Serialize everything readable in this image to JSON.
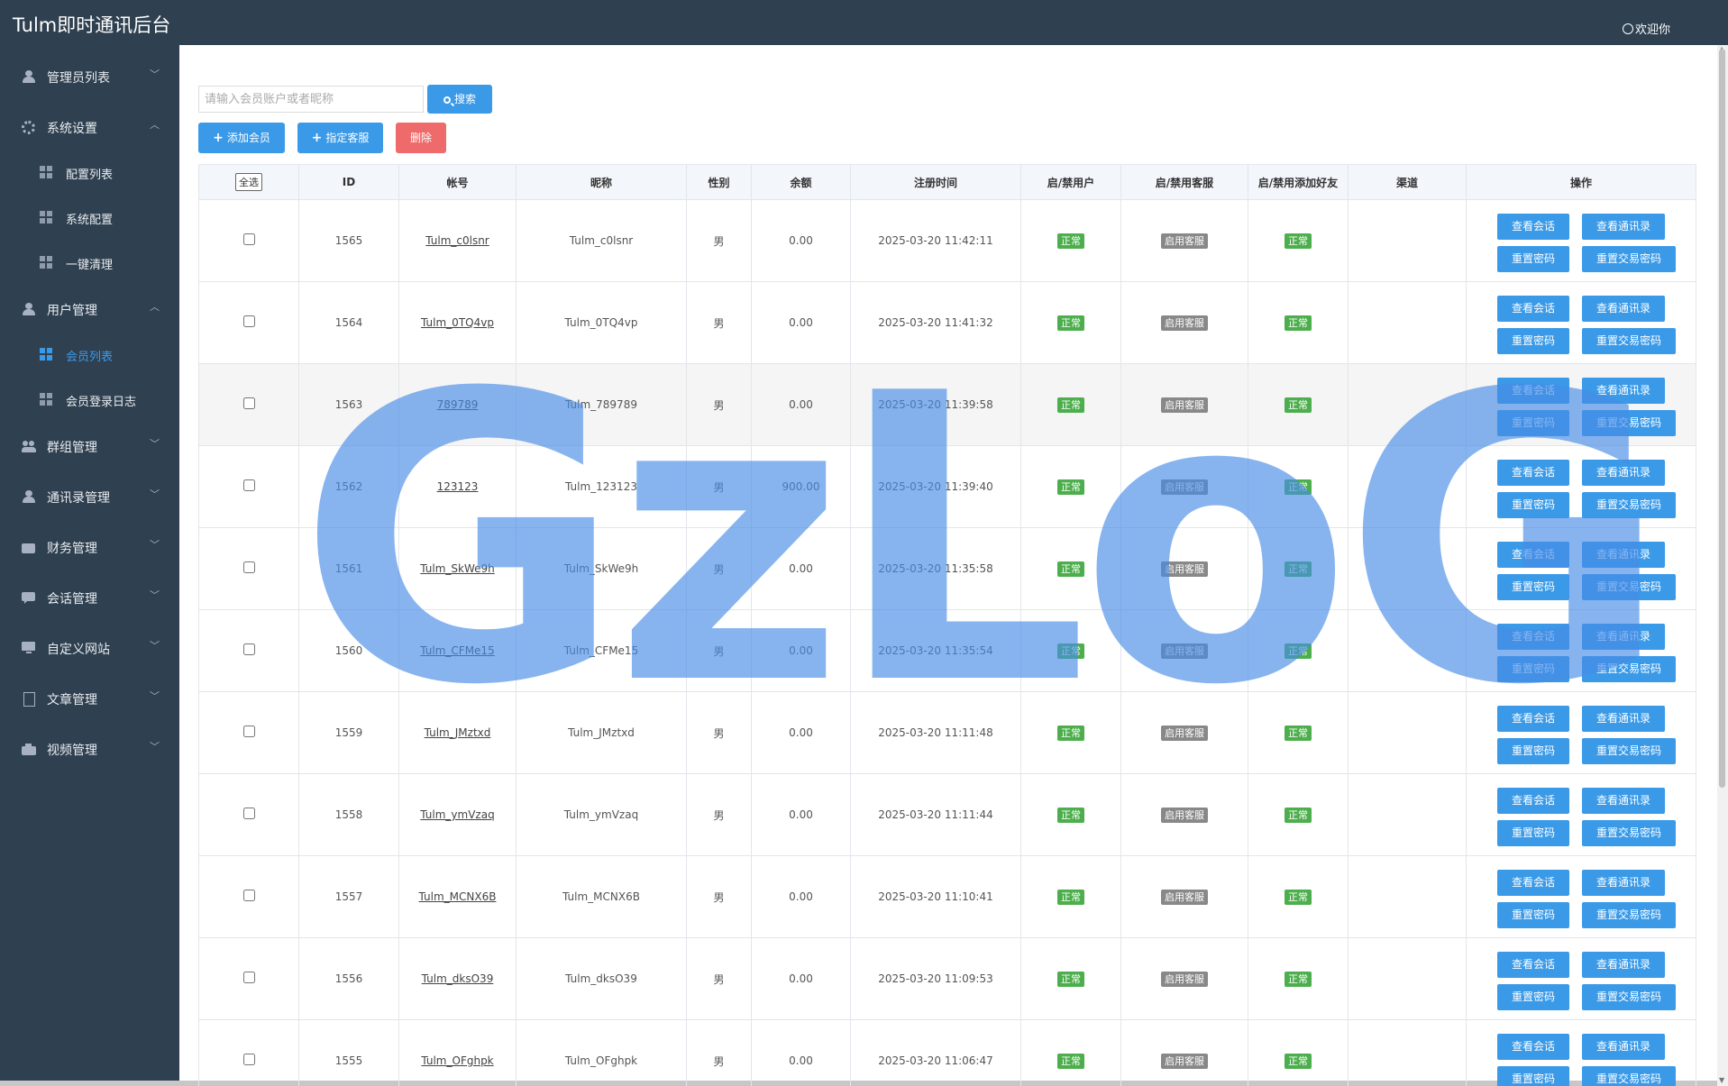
{
  "app": {
    "title": "Tulm即时通讯后台",
    "welcome": "欢迎你"
  },
  "sidebar": {
    "groups": [
      {
        "label": "管理员列表",
        "icon": "person-icon",
        "expanded": false
      },
      {
        "label": "系统设置",
        "icon": "gear-icon",
        "expanded": true,
        "items": [
          {
            "label": "配置列表"
          },
          {
            "label": "系统配置"
          },
          {
            "label": "一键清理"
          }
        ]
      },
      {
        "label": "用户管理",
        "icon": "person-icon",
        "expanded": true,
        "items": [
          {
            "label": "会员列表",
            "active": true
          },
          {
            "label": "会员登录日志"
          }
        ]
      },
      {
        "label": "群组管理",
        "icon": "group-icon",
        "expanded": false
      },
      {
        "label": "通讯录管理",
        "icon": "person-icon",
        "expanded": false
      },
      {
        "label": "财务管理",
        "icon": "money-icon",
        "expanded": false
      },
      {
        "label": "会话管理",
        "icon": "chat-icon",
        "expanded": false
      },
      {
        "label": "自定义网站",
        "icon": "monitor-icon",
        "expanded": false
      },
      {
        "label": "文章管理",
        "icon": "doc-icon",
        "expanded": false
      },
      {
        "label": "视频管理",
        "icon": "camera-icon",
        "expanded": false
      }
    ]
  },
  "toolbar": {
    "search_placeholder": "请输入会员账户或者昵称",
    "search_label": "搜索",
    "add_label": "添加会员",
    "assign_label": "指定客服",
    "delete_label": "删除"
  },
  "table": {
    "headers": {
      "select_all": "全选",
      "id": "ID",
      "account": "帐号",
      "nickname": "昵称",
      "gender": "性别",
      "balance": "余额",
      "reg_time": "注册时间",
      "user_status": "启/禁用户",
      "cs_status": "启/禁用客服",
      "friend_status": "启/禁用添加好友",
      "channel": "渠道",
      "ops": "操作"
    },
    "ops_labels": {
      "view_chat": "查看会话",
      "view_contacts": "查看通讯录",
      "reset_pwd": "重置密码",
      "reset_trade_pwd": "重置交易密码"
    },
    "rows": [
      {
        "id": "1565",
        "account": "Tulm_c0lsnr",
        "nickname": "Tulm_c0lsnr",
        "gender": "男",
        "balance": "0.00",
        "reg_time": "2025-03-20 11:42:11",
        "user_status": "正常",
        "cs_status": "启用客服",
        "friend_status": "正常",
        "channel": ""
      },
      {
        "id": "1564",
        "account": "Tulm_0TQ4vp",
        "nickname": "Tulm_0TQ4vp",
        "gender": "男",
        "balance": "0.00",
        "reg_time": "2025-03-20 11:41:32",
        "user_status": "正常",
        "cs_status": "启用客服",
        "friend_status": "正常",
        "channel": ""
      },
      {
        "id": "1563",
        "account": "789789",
        "nickname": "Tulm_789789",
        "gender": "男",
        "balance": "0.00",
        "reg_time": "2025-03-20 11:39:58",
        "user_status": "正常",
        "cs_status": "启用客服",
        "friend_status": "正常",
        "channel": ""
      },
      {
        "id": "1562",
        "account": "123123",
        "nickname": "Tulm_123123",
        "gender": "男",
        "balance": "900.00",
        "reg_time": "2025-03-20 11:39:40",
        "user_status": "正常",
        "cs_status": "启用客服",
        "friend_status": "正常",
        "channel": ""
      },
      {
        "id": "1561",
        "account": "Tulm_SkWe9h",
        "nickname": "Tulm_SkWe9h",
        "gender": "男",
        "balance": "0.00",
        "reg_time": "2025-03-20 11:35:58",
        "user_status": "正常",
        "cs_status": "启用客服",
        "friend_status": "正常",
        "channel": ""
      },
      {
        "id": "1560",
        "account": "Tulm_CFMe15",
        "nickname": "Tulm_CFMe15",
        "gender": "男",
        "balance": "0.00",
        "reg_time": "2025-03-20 11:35:54",
        "user_status": "正常",
        "cs_status": "启用客服",
        "friend_status": "正常",
        "channel": ""
      },
      {
        "id": "1559",
        "account": "Tulm_JMztxd",
        "nickname": "Tulm_JMztxd",
        "gender": "男",
        "balance": "0.00",
        "reg_time": "2025-03-20 11:11:48",
        "user_status": "正常",
        "cs_status": "启用客服",
        "friend_status": "正常",
        "channel": ""
      },
      {
        "id": "1558",
        "account": "Tulm_ymVzaq",
        "nickname": "Tulm_ymVzaq",
        "gender": "男",
        "balance": "0.00",
        "reg_time": "2025-03-20 11:11:44",
        "user_status": "正常",
        "cs_status": "启用客服",
        "friend_status": "正常",
        "channel": ""
      },
      {
        "id": "1557",
        "account": "Tulm_MCNX6B",
        "nickname": "Tulm_MCNX6B",
        "gender": "男",
        "balance": "0.00",
        "reg_time": "2025-03-20 11:10:41",
        "user_status": "正常",
        "cs_status": "启用客服",
        "friend_status": "正常",
        "channel": ""
      },
      {
        "id": "1556",
        "account": "Tulm_dksO39",
        "nickname": "Tulm_dksO39",
        "gender": "男",
        "balance": "0.00",
        "reg_time": "2025-03-20 11:09:53",
        "user_status": "正常",
        "cs_status": "启用客服",
        "friend_status": "正常",
        "channel": ""
      },
      {
        "id": "1555",
        "account": "Tulm_OFghpk",
        "nickname": "Tulm_OFghpk",
        "gender": "男",
        "balance": "0.00",
        "reg_time": "2025-03-20 11:06:47",
        "user_status": "正常",
        "cs_status": "启用客服",
        "friend_status": "正常",
        "channel": ""
      }
    ]
  },
  "watermark": "GzLoG"
}
